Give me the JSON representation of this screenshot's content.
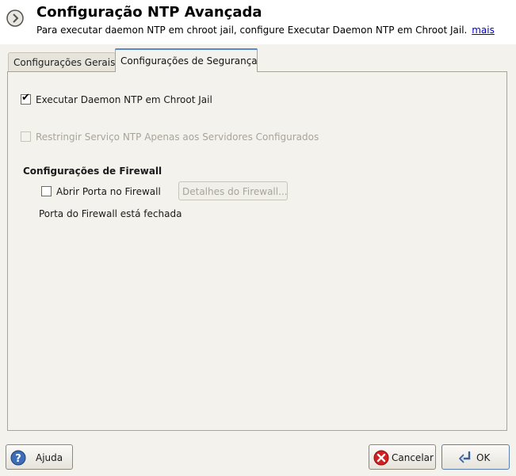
{
  "header": {
    "title": "Configuração NTP Avançada",
    "subtitle": "Para executar daemon NTP em chroot jail, configure Executar Daemon NTP em Chroot Jail.",
    "more_link": "mais"
  },
  "tabs": [
    {
      "label": "Configurações Gerais",
      "active": false
    },
    {
      "label": "Configurações de Segurança",
      "active": true
    }
  ],
  "security": {
    "run_chroot": {
      "label": "Executar Daemon NTP em Chroot Jail",
      "checked": true
    },
    "restrict_service": {
      "label": "Restringir Serviço NTP Apenas aos Servidores Configurados",
      "checked": false,
      "enabled": false
    },
    "firewall": {
      "section_title": "Configurações de Firewall",
      "open_port": {
        "label": "Abrir Porta no Firewall",
        "checked": false
      },
      "details_button": "Detalhes do Firewall...",
      "status": "Porta do Firewall está fechada"
    }
  },
  "buttons": {
    "help": "Ajuda",
    "cancel": "Cancelar",
    "ok": "OK"
  },
  "icons": {
    "app": "ntp-config-icon",
    "help": "help-icon",
    "cancel": "cancel-icon",
    "ok": "enter-icon"
  },
  "colors": {
    "link": "#0000cc",
    "active_tab_accent": "#5b89c8",
    "disabled_text": "#a8a49b"
  }
}
